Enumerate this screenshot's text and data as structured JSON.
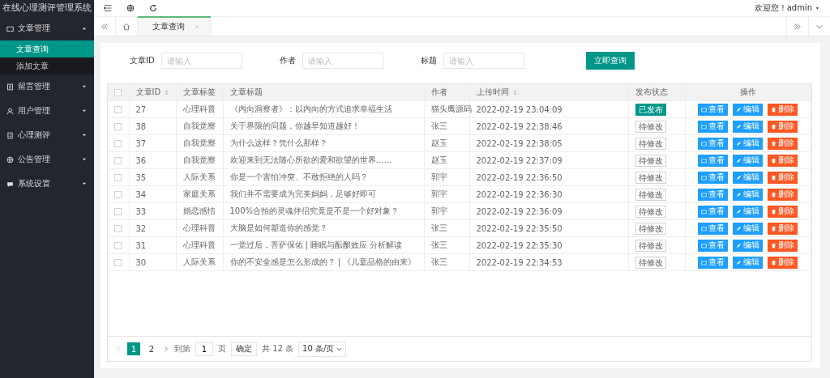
{
  "sidebar": {
    "title": "在线心理测评管理系统",
    "items": [
      {
        "label": "文章管理",
        "expanded": true,
        "children": [
          {
            "label": "文章查询",
            "selected": true
          },
          {
            "label": "添加文章",
            "selected": false
          }
        ]
      },
      {
        "label": "留言管理",
        "expanded": false
      },
      {
        "label": "用户管理",
        "expanded": false
      },
      {
        "label": "心理测评",
        "expanded": false
      },
      {
        "label": "公告管理",
        "expanded": false
      },
      {
        "label": "系统设置",
        "expanded": false
      }
    ]
  },
  "topbar": {
    "user": "欢迎您！admin"
  },
  "tabs": [
    {
      "label": "文章查询",
      "selected": true
    }
  ],
  "search": {
    "fields": [
      {
        "label": "文章ID",
        "placeholder": "请输入"
      },
      {
        "label": "作者",
        "placeholder": "请输入"
      },
      {
        "label": "标题",
        "placeholder": "请输入"
      }
    ],
    "button": "立即查询"
  },
  "table": {
    "columns": [
      {
        "label": "文章ID",
        "sortable": true
      },
      {
        "label": "文章标签",
        "sortable": false
      },
      {
        "label": "文章标题",
        "sortable": false
      },
      {
        "label": "作者",
        "sortable": false
      },
      {
        "label": "上传时间",
        "sortable": true
      },
      {
        "label": "发布状态",
        "sortable": false
      },
      {
        "label": "操作",
        "sortable": false
      }
    ],
    "header_checked": false,
    "rows": [
      {
        "checked": false,
        "id": "27",
        "tag": "心理科普",
        "title": "《内向洞察者》：以内向的方式追求幸福生活",
        "author": "猫头鹰源码",
        "time": "2022-02-19 23:04:09",
        "status": "已发布",
        "published": true,
        "actions": [
          {
            "label": "查看",
            "kind": "view"
          },
          {
            "label": "编辑",
            "kind": "edit"
          },
          {
            "label": "删除",
            "kind": "delete"
          }
        ]
      },
      {
        "checked": false,
        "id": "38",
        "tag": "自我觉察",
        "title": "关于界限的问题，你越早知道越好！",
        "author": "张三",
        "time": "2022-02-19 22:38:46",
        "status": "待修改",
        "published": false,
        "actions": [
          {
            "label": "查看",
            "kind": "view"
          },
          {
            "label": "编辑",
            "kind": "edit"
          },
          {
            "label": "删除",
            "kind": "delete"
          }
        ]
      },
      {
        "checked": false,
        "id": "37",
        "tag": "自我觉察",
        "title": "为什么这样？凭什么那样？",
        "author": "赵玉",
        "time": "2022-02-19 22:38:05",
        "status": "待修改",
        "published": false,
        "actions": [
          {
            "label": "查看",
            "kind": "view"
          },
          {
            "label": "编辑",
            "kind": "edit"
          },
          {
            "label": "删除",
            "kind": "delete"
          }
        ]
      },
      {
        "checked": false,
        "id": "36",
        "tag": "自我觉察",
        "title": "欢迎来到无法随心所欲的爱和欲望的世界……",
        "author": "赵玉",
        "time": "2022-02-19 22:37:09",
        "status": "待修改",
        "published": false,
        "actions": [
          {
            "label": "查看",
            "kind": "view"
          },
          {
            "label": "编辑",
            "kind": "edit"
          },
          {
            "label": "删除",
            "kind": "delete"
          }
        ]
      },
      {
        "checked": false,
        "id": "35",
        "tag": "人际关系",
        "title": "你是一个害怕冲突、不敢拒绝的人吗？",
        "author": "郭宇",
        "time": "2022-02-19 22:36:50",
        "status": "待修改",
        "published": false,
        "actions": [
          {
            "label": "查看",
            "kind": "view"
          },
          {
            "label": "编辑",
            "kind": "edit"
          },
          {
            "label": "删除",
            "kind": "delete"
          }
        ]
      },
      {
        "checked": false,
        "id": "34",
        "tag": "家庭关系",
        "title": "我们并不需要成为完美妈妈，足够好即可",
        "author": "郭宇",
        "time": "2022-02-19 22:36:30",
        "status": "待修改",
        "published": false,
        "actions": [
          {
            "label": "查看",
            "kind": "view"
          },
          {
            "label": "编辑",
            "kind": "edit"
          },
          {
            "label": "删除",
            "kind": "delete"
          }
        ]
      },
      {
        "checked": false,
        "id": "33",
        "tag": "婚恋感情",
        "title": "100%合拍的灵魂伴侣究竟是不是一个好对象？",
        "author": "郭宇",
        "time": "2022-02-19 22:36:09",
        "status": "待修改",
        "published": false,
        "actions": [
          {
            "label": "查看",
            "kind": "view"
          },
          {
            "label": "编辑",
            "kind": "edit"
          },
          {
            "label": "删除",
            "kind": "delete"
          }
        ]
      },
      {
        "checked": false,
        "id": "32",
        "tag": "心理科普",
        "title": "大脑是如何塑造你的感觉？",
        "author": "张三",
        "time": "2022-02-19 22:35:50",
        "status": "待修改",
        "published": false,
        "actions": [
          {
            "label": "查看",
            "kind": "view"
          },
          {
            "label": "编辑",
            "kind": "edit"
          },
          {
            "label": "删除",
            "kind": "delete"
          }
        ]
      },
      {
        "checked": false,
        "id": "31",
        "tag": "心理科普",
        "title": "一觉过后，菩萨保佑 | 睡眠与酝酿效应 分析解读",
        "author": "张三",
        "time": "2022-02-19 22:35:30",
        "status": "待修改",
        "published": false,
        "actions": [
          {
            "label": "查看",
            "kind": "view"
          },
          {
            "label": "编辑",
            "kind": "edit"
          },
          {
            "label": "删除",
            "kind": "delete"
          }
        ]
      },
      {
        "checked": false,
        "id": "30",
        "tag": "人际关系",
        "title": "你的不安全感是怎么形成的？ | 《儿童品格的由来》",
        "author": "张三",
        "time": "2022-02-19 22:34:53",
        "status": "待修改",
        "published": false,
        "actions": [
          {
            "label": "查看",
            "kind": "view"
          },
          {
            "label": "编辑",
            "kind": "edit"
          },
          {
            "label": "删除",
            "kind": "delete"
          }
        ]
      }
    ]
  },
  "pager": {
    "pages": [
      {
        "label": "1",
        "selected": true
      },
      {
        "label": "2",
        "selected": false
      }
    ],
    "goto_label": "到第",
    "goto_value": "1",
    "page_unit": "页",
    "confirm": "确定",
    "total": "共 12 条",
    "page_size": "10 条/页"
  }
}
